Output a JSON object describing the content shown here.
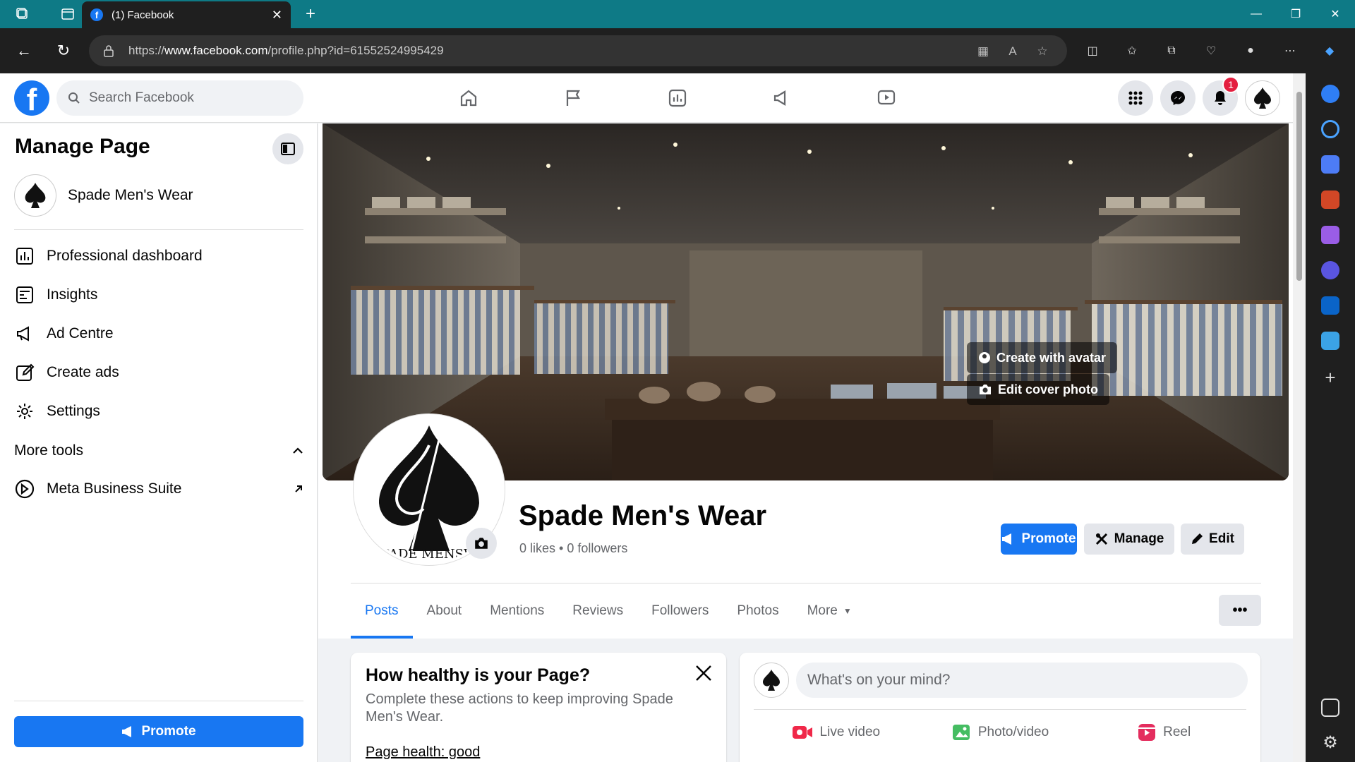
{
  "browser": {
    "tab_title": "(1) Facebook",
    "url_prefix": "https://",
    "url_host": "www.facebook.com",
    "url_path": "/profile.php?id=61552524995429"
  },
  "topbar": {
    "search_placeholder": "Search Facebook",
    "notification_count": "1"
  },
  "sidebar": {
    "title": "Manage Page",
    "page_name": "Spade Men's Wear",
    "items": [
      {
        "label": "Professional dashboard",
        "icon": "dashboard-icon"
      },
      {
        "label": "Insights",
        "icon": "insights-icon"
      },
      {
        "label": "Ad Centre",
        "icon": "megaphone-icon"
      },
      {
        "label": "Create ads",
        "icon": "edit-icon"
      },
      {
        "label": "Settings",
        "icon": "gear-icon"
      }
    ],
    "more_tools": "More tools",
    "meta_business_suite": "Meta Business Suite",
    "promote": "Promote"
  },
  "cover": {
    "create_avatar": "Create with avatar",
    "edit_cover": "Edit cover photo"
  },
  "profile": {
    "avatar_caption": "PADE MENSW",
    "name": "Spade Men's Wear",
    "stats": "0 likes • 0 followers",
    "promote": "Promote",
    "manage": "Manage",
    "edit": "Edit"
  },
  "tabs": [
    "Posts",
    "About",
    "Mentions",
    "Reviews",
    "Followers",
    "Photos",
    "More"
  ],
  "health": {
    "title": "How healthy is your Page?",
    "desc_prefix": "Complete these actions to keep improving",
    "desc_name": "Spade Men's Wear",
    "desc_suffix": ".",
    "status": "Page health: good"
  },
  "composer": {
    "placeholder": "What's on your mind?",
    "live_video": "Live video",
    "photo_video": "Photo/video",
    "reel": "Reel"
  },
  "colors": {
    "facebook_blue": "#1877f2",
    "edge_titlebar": "#0e7a86",
    "notification_red": "#e41e3f"
  }
}
